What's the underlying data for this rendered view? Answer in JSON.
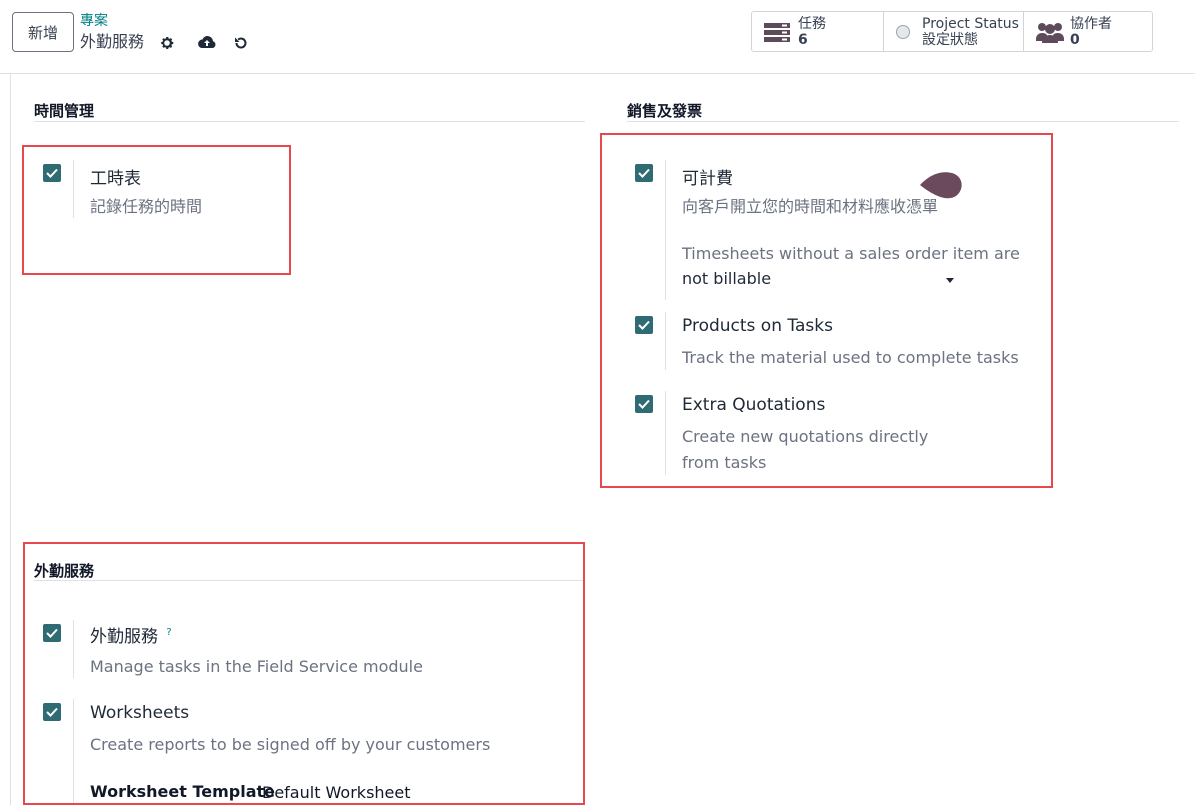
{
  "header": {
    "new_button": "新增",
    "breadcrumb": "專案",
    "record_name": "外勤服務"
  },
  "stats": {
    "tasks": {
      "label": "任務",
      "value": "6"
    },
    "project_status": {
      "label": "Project Status",
      "value": "設定狀態"
    },
    "collaborators": {
      "label": "協作者",
      "value": "0"
    }
  },
  "sections": {
    "time": {
      "title": "時間管理",
      "timesheets": {
        "title": "工時表",
        "desc": "記錄任務的時間"
      }
    },
    "sales": {
      "title": "銷售及發票",
      "billable": {
        "title": "可計費",
        "desc": "向客戶開立您的時間和材料應收憑單",
        "select_label": "Timesheets without a sales order item are",
        "select_value": "not billable"
      },
      "products": {
        "title": "Products on Tasks",
        "desc": "Track the material used to complete tasks"
      },
      "quotations": {
        "title": "Extra Quotations",
        "desc_line1": "Create new quotations directly",
        "desc_line2": "from tasks"
      }
    },
    "field": {
      "title": "外勤服務",
      "field_service": {
        "title": "外勤服務",
        "help": "?",
        "desc": "Manage tasks in the Field Service module"
      },
      "worksheets": {
        "title": "Worksheets",
        "desc": "Create reports to be signed off by your customers",
        "template_label": "Worksheet Template",
        "template_value": "Default Worksheet"
      }
    }
  },
  "colors": {
    "accent": "#017e84",
    "checkbox": "#2e6b73",
    "highlight": "#e5484d",
    "cursor": "#6b4a5e"
  }
}
